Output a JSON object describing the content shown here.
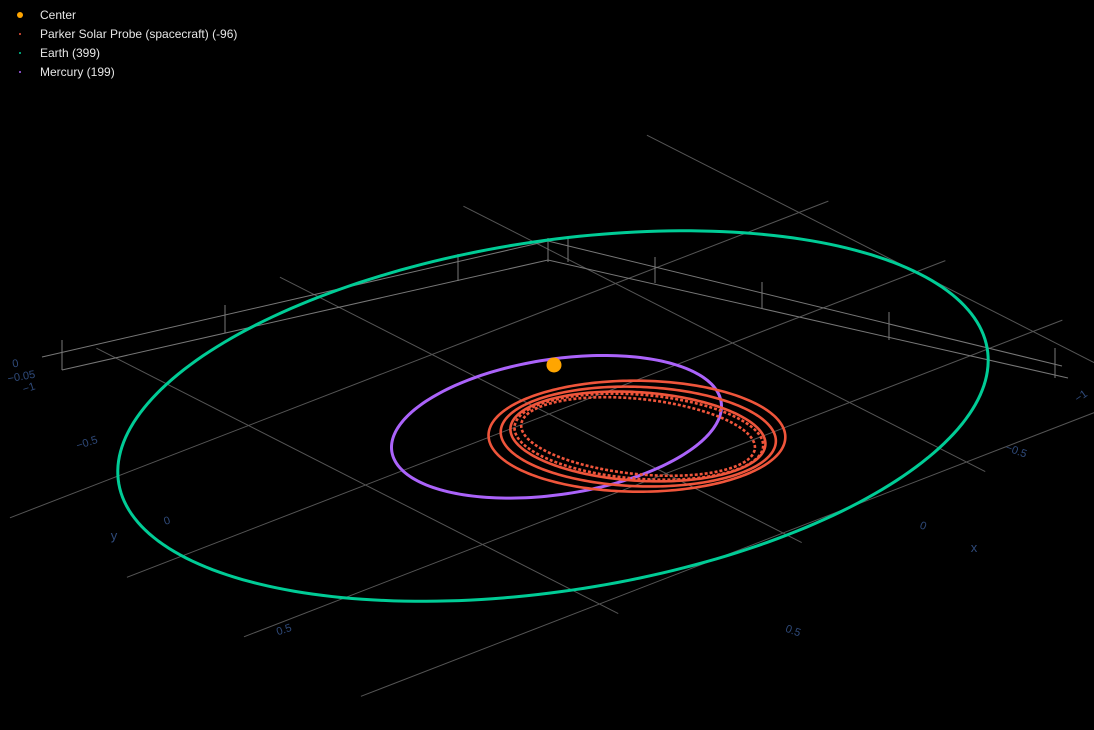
{
  "legend": {
    "items": [
      {
        "label": "Center",
        "color": "#ffa500",
        "marker": "dot-large"
      },
      {
        "label": "Parker Solar Probe (spacecraft) (-96)",
        "color": "#ef553b",
        "marker": "dot-small"
      },
      {
        "label": "Earth (399)",
        "color": "#00cc96",
        "marker": "dot-small"
      },
      {
        "label": "Mercury (199)",
        "color": "#ab63fa",
        "marker": "dot-small"
      }
    ]
  },
  "chart_data": {
    "type": "scatter3d",
    "title": "",
    "background": "#000000",
    "grid": true,
    "axes": {
      "x": {
        "title": "x",
        "ticks": [
          "−1",
          "−0.5",
          "0",
          "0.5"
        ],
        "range": [
          -1,
          1
        ]
      },
      "y": {
        "title": "y",
        "ticks": [
          "−1",
          "−0.5",
          "0",
          "0.5"
        ],
        "range": [
          -1,
          1
        ]
      },
      "z": {
        "title": "",
        "ticks": [
          "0",
          "−0.05"
        ],
        "range": [
          -0.08,
          0.02
        ]
      }
    },
    "series": [
      {
        "name": "Center",
        "color": "#ffa500",
        "points": [
          {
            "x": 0,
            "y": 0,
            "z": 0
          }
        ]
      },
      {
        "name": "Parker Solar Probe (spacecraft) (-96)",
        "color": "#ef553b",
        "orbits": [
          {
            "a": 0.39,
            "e": 0.71
          },
          {
            "a": 0.37,
            "e": 0.76
          },
          {
            "a": 0.35,
            "e": 0.8
          },
          {
            "a": 0.345,
            "e": 0.82
          },
          {
            "a": 0.33,
            "e": 0.85
          }
        ]
      },
      {
        "name": "Earth (399)",
        "color": "#00cc96",
        "orbit": {
          "a": 1.0,
          "e": 0.017
        }
      },
      {
        "name": "Mercury (199)",
        "color": "#ab63fa",
        "orbit": {
          "a": 0.387,
          "e": 0.206
        }
      }
    ]
  }
}
